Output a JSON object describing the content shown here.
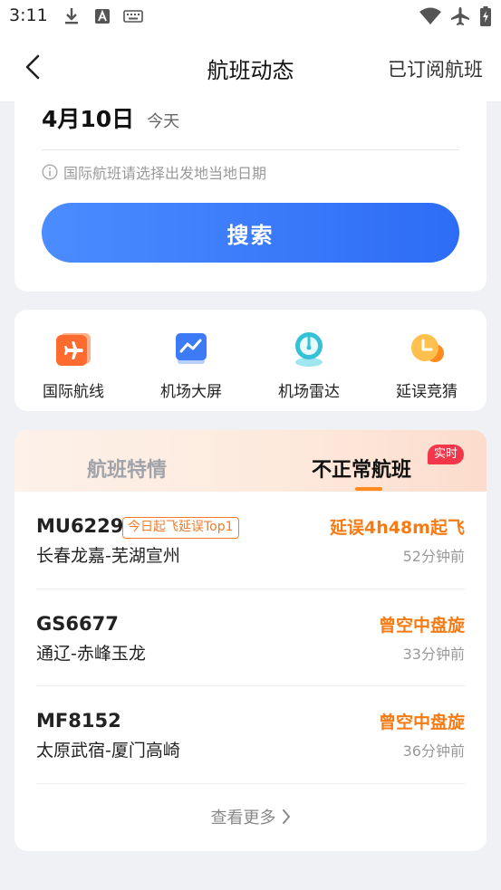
{
  "status_bar": {
    "time": "3:11",
    "icons": [
      "download-icon",
      "text-a-icon",
      "keyboard-icon",
      "wifi-icon",
      "airplane-mode-icon",
      "battery-charging-icon"
    ]
  },
  "nav": {
    "title": "航班动态",
    "right_action": "已订阅航班"
  },
  "search_card": {
    "date": "4月10日",
    "date_note": "今天",
    "hint": "国际航班请选择出发地当地日期",
    "search_label": "搜索"
  },
  "shortcuts": [
    {
      "label": "国际航线",
      "icon": "plane-square-icon"
    },
    {
      "label": "机场大屏",
      "icon": "trend-screen-icon"
    },
    {
      "label": "机场雷达",
      "icon": "radar-gauge-icon"
    },
    {
      "label": "延误竞猜",
      "icon": "clock-coin-icon"
    }
  ],
  "tabs": {
    "inactive": "航班特情",
    "active": "不正常航班",
    "badge": "实时"
  },
  "flights": [
    {
      "no": "MU6229",
      "tag": "今日起飞延误Top1",
      "route": "长春龙嘉-芜湖宣州",
      "status": "延误4h48m起飞",
      "time_ago": "52分钟前"
    },
    {
      "no": "GS6677",
      "tag": "",
      "route": "通辽-赤峰玉龙",
      "status": "曾空中盘旋",
      "time_ago": "33分钟前"
    },
    {
      "no": "MF8152",
      "tag": "",
      "route": "太原武宿-厦门高崎",
      "status": "曾空中盘旋",
      "time_ago": "36分钟前"
    }
  ],
  "see_more": "查看更多",
  "colors": {
    "accent_blue": "#2d6cf5",
    "status_orange": "#f57b14",
    "badge_red": "#f2374a"
  }
}
